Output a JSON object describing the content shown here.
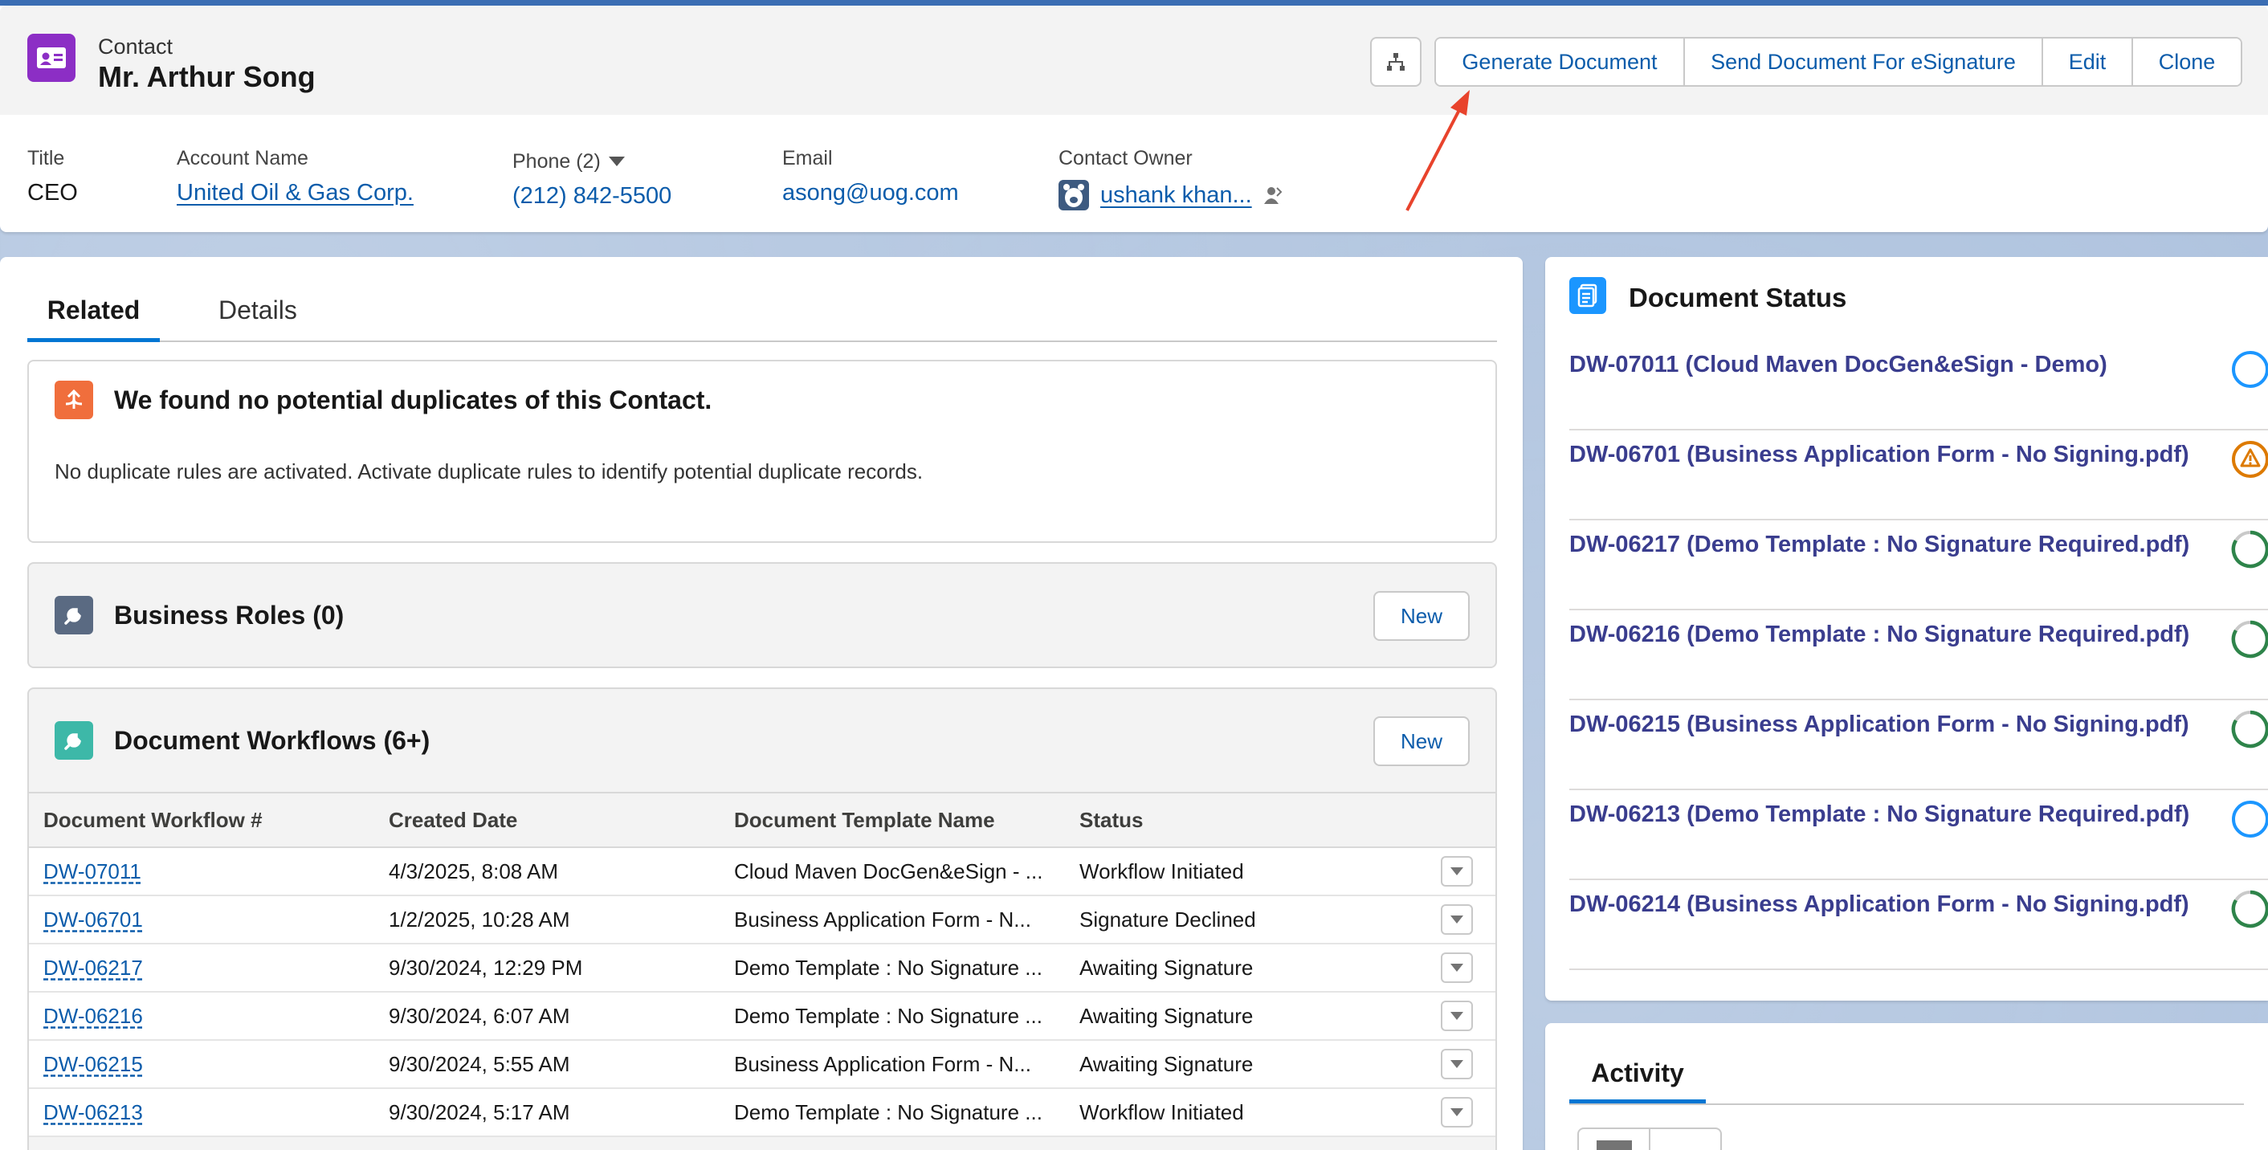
{
  "record": {
    "object_type": "Contact",
    "name": "Mr. Arthur Song"
  },
  "actions": {
    "generate_document": "Generate Document",
    "send_for_esignature": "Send Document For eSignature",
    "edit": "Edit",
    "clone": "Clone"
  },
  "highlights": {
    "title_label": "Title",
    "title_value": "CEO",
    "account_label": "Account Name",
    "account_value": "United Oil & Gas Corp.",
    "phone_label": "Phone (2)",
    "phone_value": "(212) 842-5500",
    "email_label": "Email",
    "email_value": "asong@uog.com",
    "owner_label": "Contact Owner",
    "owner_value": "ushank khan..."
  },
  "tabs": {
    "related": "Related",
    "details": "Details"
  },
  "duplicates": {
    "title": "We found no potential duplicates of this Contact.",
    "message": "No duplicate rules are activated. Activate duplicate rules to identify potential duplicate records."
  },
  "business_roles": {
    "title": "Business Roles (0)",
    "new_label": "New"
  },
  "workflows": {
    "title": "Document Workflows (6+)",
    "new_label": "New",
    "columns": [
      "Document Workflow #",
      "Created Date",
      "Document Template Name",
      "Status"
    ],
    "rows": [
      {
        "id": "DW-07011",
        "created": "4/3/2025, 8:08 AM",
        "template": "Cloud Maven DocGen&eSign - ...",
        "status": "Workflow Initiated"
      },
      {
        "id": "DW-06701",
        "created": "1/2/2025, 10:28 AM",
        "template": "Business Application Form - N...",
        "status": "Signature Declined"
      },
      {
        "id": "DW-06217",
        "created": "9/30/2024, 12:29 PM",
        "template": "Demo Template : No Signature ...",
        "status": "Awaiting Signature"
      },
      {
        "id": "DW-06216",
        "created": "9/30/2024, 6:07 AM",
        "template": "Demo Template : No Signature ...",
        "status": "Awaiting Signature"
      },
      {
        "id": "DW-06215",
        "created": "9/30/2024, 5:55 AM",
        "template": "Business Application Form - N...",
        "status": "Awaiting Signature"
      },
      {
        "id": "DW-06213",
        "created": "9/30/2024, 5:17 AM",
        "template": "Demo Template : No Signature ...",
        "status": "Workflow Initiated"
      }
    ]
  },
  "document_status": {
    "title": "Document Status",
    "items": [
      {
        "label": "DW-07011 (Cloud Maven DocGen&eSign - Demo)",
        "status_icon": "open-circle-icon"
      },
      {
        "label": "DW-06701 (Business Application Form - No Signing.pdf)",
        "status_icon": "warning-icon"
      },
      {
        "label": "DW-06217 (Demo Template : No Signature Required.pdf)",
        "status_icon": "progress-ring-icon"
      },
      {
        "label": "DW-06216 (Demo Template : No Signature Required.pdf)",
        "status_icon": "progress-ring-icon"
      },
      {
        "label": "DW-06215 (Business Application Form - No Signing.pdf)",
        "status_icon": "progress-ring-icon"
      },
      {
        "label": "DW-06213 (Demo Template : No Signature Required.pdf)",
        "status_icon": "open-circle-icon"
      },
      {
        "label": "DW-06214 (Business Application Form - No Signing.pdf)",
        "status_icon": "progress-ring-icon"
      }
    ]
  },
  "activity": {
    "tab_label": "Activity"
  },
  "colors": {
    "brand_blue": "#0176d3",
    "link_blue": "#0b5cab",
    "contact_icon": "#8c2ec5",
    "annotation_arrow": "#e8432c"
  }
}
